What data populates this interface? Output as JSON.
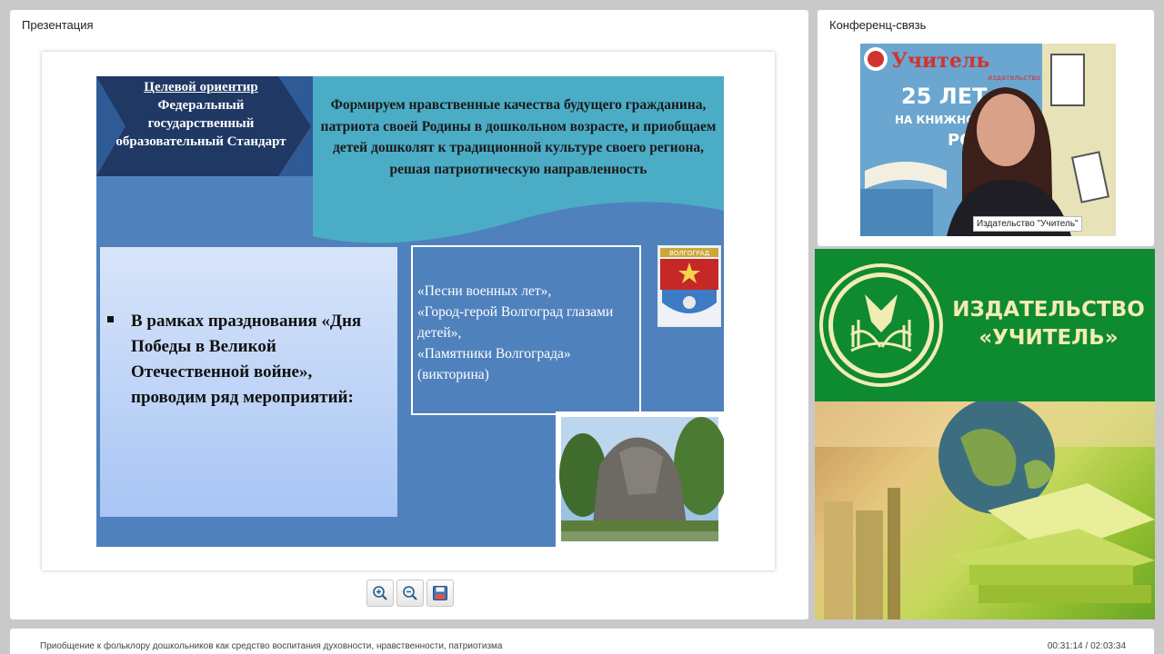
{
  "presentation_panel": {
    "title": "Презентация"
  },
  "slide": {
    "target": {
      "heading": "Целевой ориентир",
      "body": "Федеральный государственный образовательный Стандарт"
    },
    "banner_text": "Формируем нравственные качества будущего гражданина, патриота своей Родины в дошкольном возрасте, и приобщаем детей дошколят к традиционной культуре своего региона, решая патриотическую направленность",
    "left_text": "В рамках празднования «Дня Победы в Великой Отечественной войне», проводим ряд мероприятий:",
    "events": [
      "«Песни военных лет»,",
      "«Город-герой Волгоград глазами детей»,",
      "«Памятники Волгограда» (викторина)"
    ],
    "coat_label": "ВОЛГОГРАД"
  },
  "zoom_controls": {
    "zoom_in": "zoom-in-icon",
    "zoom_out": "zoom-out-icon",
    "save": "save-icon"
  },
  "conference_panel": {
    "title": "Конференц-связь",
    "video_label": "Издательство \"Учитель\"",
    "banner_logo": "Учитель",
    "banner_sub": "издательство",
    "banner_years": "25 ЛЕТ",
    "banner_line": "НА КНИЖНОМ",
    "banner_tail": "РОС"
  },
  "brand_block": {
    "name_line1": "ИЗДАТЕЛЬСТВО",
    "name_line2": "«УЧИТЕЛЬ»"
  },
  "footer": {
    "title": "Приобщение к фольклору дошкольников как средство воспитания духовности, нравственности, патриотизма",
    "time": "00:31:14 / 02:03:34"
  },
  "colors": {
    "slide_blue": "#4f81bd",
    "dark_navy": "#1f3864",
    "banner_teal": "#4bacc6",
    "brand_green": "#0e8a31",
    "brand_cream": "#f2ecb3"
  }
}
